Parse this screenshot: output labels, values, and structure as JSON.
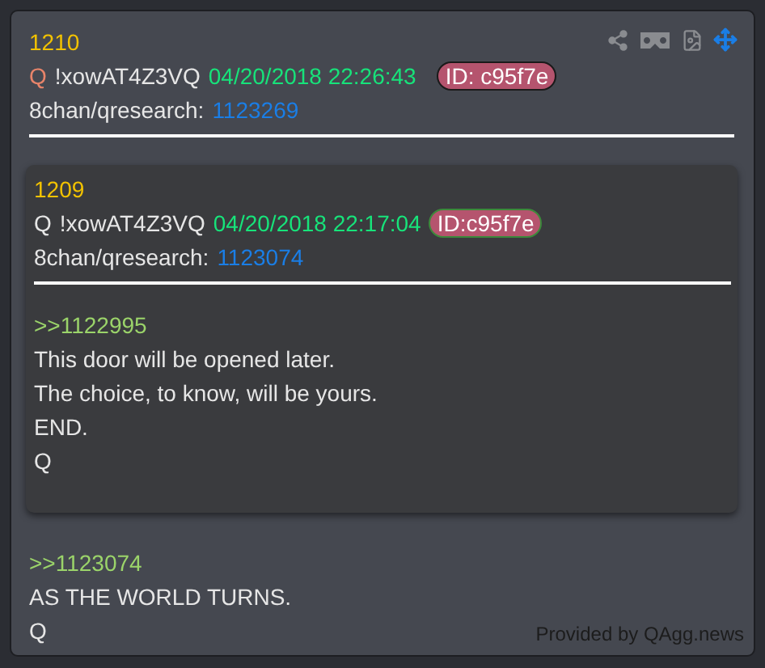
{
  "post": {
    "number": "1210",
    "author": {
      "text": "Q",
      "color": "#e8846a"
    },
    "tripcode": "!xowAT4Z3VQ",
    "timestamp": "04/20/2018 22:26:43",
    "id": "ID: c95f7e",
    "board": "8chan/qresearch:",
    "post_link": "1123269",
    "quote": {
      "number": "1209",
      "author": {
        "text": "Q",
        "color": "#e6e6e6"
      },
      "tripcode": "!xowAT4Z3VQ",
      "timestamp": "04/20/2018 22:17:04",
      "id": "ID:c95f7e",
      "board": "8chan/qresearch:",
      "post_link": "1123074",
      "body": [
        {
          "kind": "reply-link",
          "text": ">>1122995"
        },
        {
          "kind": "line",
          "text": "This door will be opened later."
        },
        {
          "kind": "line",
          "text": "The choice, to know, will be yours."
        },
        {
          "kind": "line",
          "text": "END."
        },
        {
          "kind": "line",
          "text": "Q"
        }
      ]
    },
    "body": [
      {
        "kind": "reply-link",
        "text": ">>1123074"
      },
      {
        "kind": "line",
        "text": "AS THE WORLD TURNS."
      },
      {
        "kind": "line",
        "text": "Q"
      }
    ]
  },
  "footer": "Provided by QAgg.news"
}
